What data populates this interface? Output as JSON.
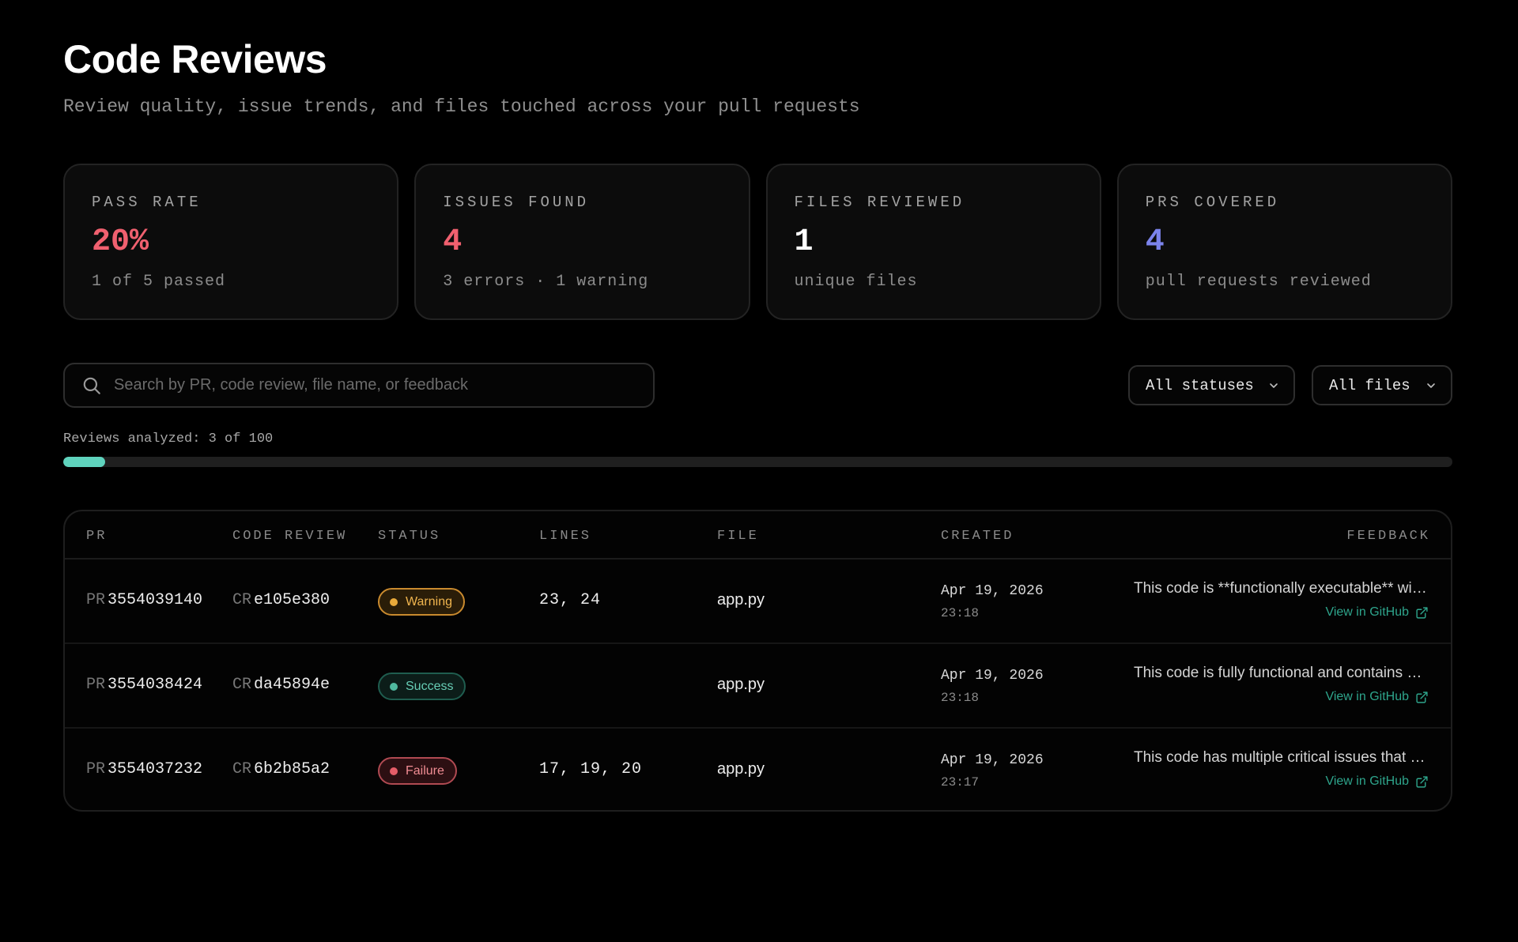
{
  "header": {
    "title": "Code Reviews",
    "subtitle": "Review quality, issue trends, and files touched across your pull requests"
  },
  "stats": [
    {
      "label": "PASS RATE",
      "value": "20%",
      "sub": "1 of 5 passed",
      "color": "#f0606f"
    },
    {
      "label": "ISSUES FOUND",
      "value": "4",
      "sub": "3 errors · 1 warning",
      "color": "#f0606f"
    },
    {
      "label": "FILES REVIEWED",
      "value": "1",
      "sub": "unique files",
      "color": "#ffffff"
    },
    {
      "label": "PRS COVERED",
      "value": "4",
      "sub": "pull requests reviewed",
      "color": "#7b83eb"
    }
  ],
  "filters": {
    "search_placeholder": "Search by PR, code review, file name, or feedback",
    "search_value": "",
    "status_select": "All statuses",
    "files_select": "All files",
    "search_icon": "search-icon",
    "chevron_icon": "chevron-down-icon"
  },
  "progress": {
    "label": "Reviews analyzed: 3 of 100",
    "analyzed": 3,
    "total": 100,
    "color": "#5fd3bd"
  },
  "table": {
    "columns": [
      "PR",
      "CODE REVIEW",
      "STATUS",
      "LINES",
      "FILE",
      "CREATED",
      "FEEDBACK"
    ],
    "pr_prefix": "PR",
    "cr_prefix": "CR",
    "link_label": "View in GitHub",
    "link_icon": "external-link-icon",
    "rows": [
      {
        "pr": "3554039140",
        "cr": "e105e380",
        "status": "Warning",
        "status_kind": "warning",
        "lines": "23, 24",
        "file": "app.py",
        "created_date": "Apr 19, 2026",
        "created_time": "23:18",
        "feedback": "This code is **functionally executable** with minor issues"
      },
      {
        "pr": "3554038424",
        "cr": "da45894e",
        "status": "Success",
        "status_kind": "success",
        "lines": "",
        "file": "app.py",
        "created_date": "Apr 19, 2026",
        "created_time": "23:18",
        "feedback": "This code is fully functional and contains no issues"
      },
      {
        "pr": "3554037232",
        "cr": "6b2b85a2",
        "status": "Failure",
        "status_kind": "failure",
        "lines": "17, 19, 20",
        "file": "app.py",
        "created_date": "Apr 19, 2026",
        "created_time": "23:17",
        "feedback": "This code has multiple critical issues that prevent it"
      }
    ]
  }
}
